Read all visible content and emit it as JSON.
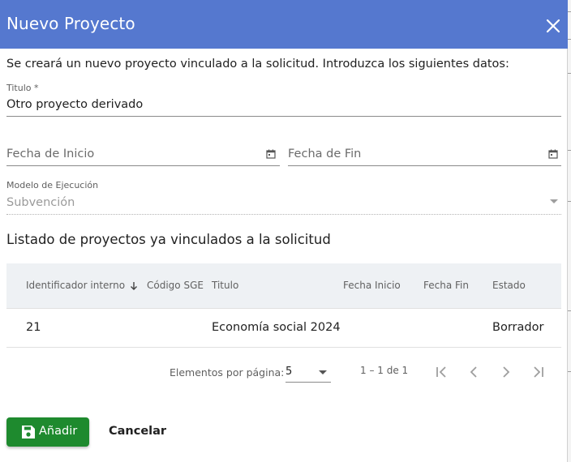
{
  "dialog": {
    "title": "Nuevo Proyecto",
    "close_icon": "close-icon",
    "intro": "Se creará un nuevo proyecto vinculado a la solicitud. Introduzca los siguientes datos:"
  },
  "form": {
    "titulo": {
      "label": "Titulo *",
      "value": "Otro proyecto derivado"
    },
    "fecha_inicio": {
      "placeholder": "Fecha de Inicio",
      "icon": "calendar-icon"
    },
    "fecha_fin": {
      "placeholder": "Fecha de Fin",
      "icon": "calendar-icon"
    },
    "modelo": {
      "label": "Modelo de Ejecución",
      "value": "Subvención",
      "disabled": true
    }
  },
  "linked": {
    "section_title": "Listado de proyectos ya vinculados a la solicitud",
    "columns": [
      "Identificador interno",
      "Código SGE",
      "Titulo",
      "Fecha Inicio",
      "Fecha Fin",
      "Estado"
    ],
    "sorted_column": "Identificador interno",
    "sort_direction": "descending",
    "rows": [
      {
        "id": "21",
        "codigo_sge": "",
        "titulo": "Economía social 2024",
        "fecha_inicio": "",
        "fecha_fin": "",
        "estado": "Borrador"
      }
    ]
  },
  "paginator": {
    "items_per_page_label": "Elementos por página:",
    "page_size": "5",
    "range": "1 – 1 de 1"
  },
  "actions": {
    "add_label": "Añadir",
    "add_icon": "save-icon",
    "cancel_label": "Cancelar"
  },
  "colors": {
    "header": "#5578cf",
    "primary_button": "#1e8a2e",
    "table_header": "#eef1f4"
  }
}
